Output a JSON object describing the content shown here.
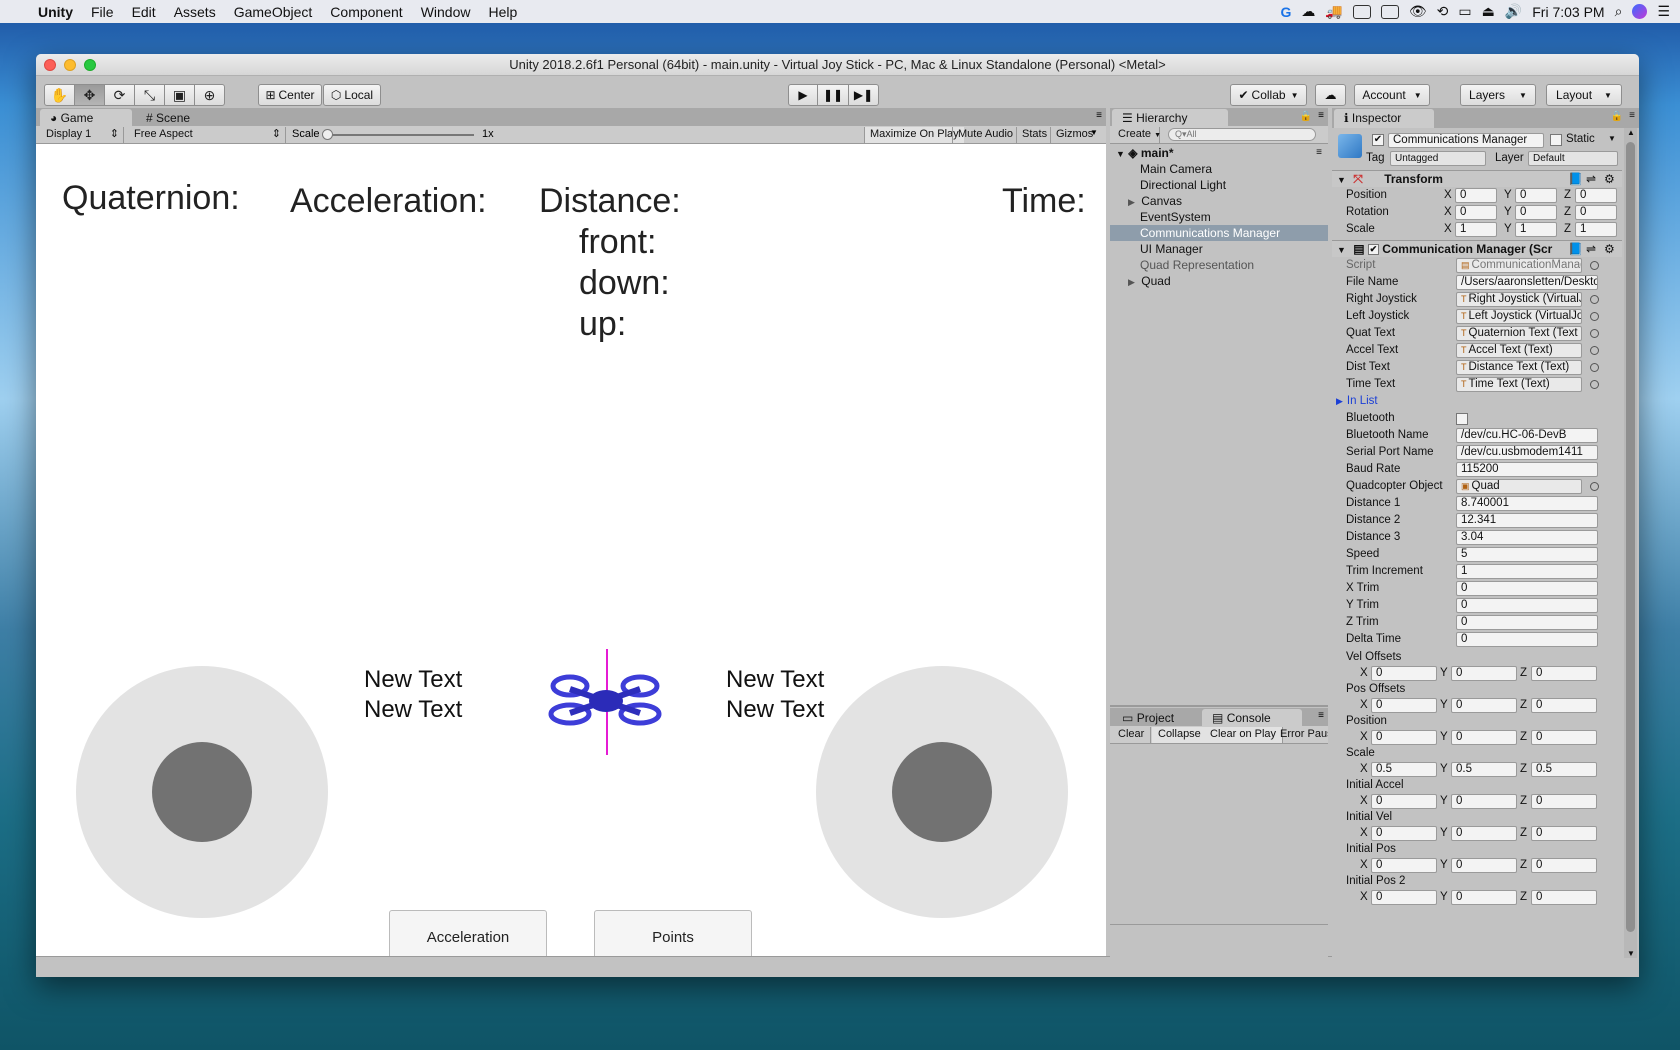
{
  "menubar": {
    "app": "Unity",
    "items": [
      "File",
      "Edit",
      "Assets",
      "GameObject",
      "Component",
      "Window",
      "Help"
    ],
    "clock": "Fri 7:03 PM"
  },
  "window": {
    "title": "Unity 2018.2.6f1 Personal (64bit) - main.unity - Virtual Joy Stick - PC, Mac & Linux Standalone (Personal) <Metal>"
  },
  "toolbar": {
    "pivot": "Center",
    "space": "Local",
    "collab": "Collab",
    "account": "Account",
    "layers": "Layers",
    "layout": "Layout"
  },
  "game_panel": {
    "tabs": [
      "Game",
      "Scene"
    ],
    "display": "Display 1",
    "aspect": "Free Aspect",
    "scale_label": "Scale",
    "scale_value": "1x",
    "buttons": [
      "Maximize On Play",
      "Mute Audio",
      "Stats",
      "Gizmos"
    ]
  },
  "game": {
    "quaternion": "Quaternion:",
    "acceleration": "Acceleration:",
    "distance": "Distance:",
    "front": "front:",
    "down": "down:",
    "up": "up:",
    "time": "Time:",
    "left_text_1": "New Text",
    "left_text_2": "New Text",
    "right_text_1": "New Text",
    "right_text_2": "New Text",
    "btn_acceleration": "Acceleration",
    "btn_points": "Points"
  },
  "hierarchy": {
    "tab": "Hierarchy",
    "create": "Create",
    "search_placeholder": "Q▾All",
    "scene": "main*",
    "items": [
      "Main Camera",
      "Directional Light",
      "Canvas",
      "EventSystem",
      "Communications Manager",
      "UI Manager",
      "Quad Representation",
      "Quad"
    ]
  },
  "bottom_panel": {
    "tabs": [
      "Project",
      "Console"
    ],
    "buttons": [
      "Clear",
      "Collapse",
      "Clear on Play",
      "Error Pause"
    ]
  },
  "inspector": {
    "tab": "Inspector",
    "object_name": "Communications Manager",
    "static": "Static",
    "tag_label": "Tag",
    "tag": "Untagged",
    "layer_label": "Layer",
    "layer": "Default",
    "transform": {
      "title": "Transform",
      "rows": [
        {
          "label": "Position",
          "x": "0",
          "y": "0",
          "z": "0"
        },
        {
          "label": "Rotation",
          "x": "0",
          "y": "0",
          "z": "0"
        },
        {
          "label": "Scale",
          "x": "1",
          "y": "1",
          "z": "1"
        }
      ]
    },
    "component_title": "Communication Manager (Scr",
    "fields": [
      {
        "label": "Script",
        "value": "CommunicationManag"
      },
      {
        "label": "File Name",
        "value": "/Users/aaronsletten/Deskto"
      },
      {
        "label": "Right Joystick",
        "value": "Right Joystick (VirtualJ"
      },
      {
        "label": "Left Joystick",
        "value": "Left Joystick (VirtualJoy"
      },
      {
        "label": "Quat Text",
        "value": "Quaternion Text (Text"
      },
      {
        "label": "Accel Text",
        "value": "Accel Text (Text)"
      },
      {
        "label": "Dist Text",
        "value": "Distance Text (Text)"
      },
      {
        "label": "Time Text",
        "value": "Time Text (Text)"
      },
      {
        "label": "In List",
        "value": ""
      },
      {
        "label": "Bluetooth",
        "value": ""
      },
      {
        "label": "Bluetooth Name",
        "value": "/dev/cu.HC-06-DevB"
      },
      {
        "label": "Serial Port Name",
        "value": "/dev/cu.usbmodem1411"
      },
      {
        "label": "Baud Rate",
        "value": "115200"
      },
      {
        "label": "Quadcopter Object",
        "value": "Quad"
      },
      {
        "label": "Distance 1",
        "value": "8.740001"
      },
      {
        "label": "Distance 2",
        "value": "12.341"
      },
      {
        "label": "Distance 3",
        "value": "3.04"
      },
      {
        "label": "Speed",
        "value": "5"
      },
      {
        "label": "Trim Increment",
        "value": "1"
      },
      {
        "label": "X Trim",
        "value": "0"
      },
      {
        "label": "Y Trim",
        "value": "0"
      },
      {
        "label": "Z Trim",
        "value": "0"
      },
      {
        "label": "Delta Time",
        "value": "0"
      }
    ],
    "vectors": [
      {
        "label": "Vel Offsets",
        "x": "0",
        "y": "0",
        "z": "0"
      },
      {
        "label": "Pos Offsets",
        "x": "0",
        "y": "0",
        "z": "0"
      },
      {
        "label": "Position",
        "x": "0",
        "y": "0",
        "z": "0"
      },
      {
        "label": "Scale",
        "x": "0.5",
        "y": "0.5",
        "z": "0.5"
      },
      {
        "label": "Initial Accel",
        "x": "0",
        "y": "0",
        "z": "0"
      },
      {
        "label": "Initial Vel",
        "x": "0",
        "y": "0",
        "z": "0"
      },
      {
        "label": "Initial Pos",
        "x": "0",
        "y": "0",
        "z": "0"
      },
      {
        "label": "Initial Pos 2",
        "x": "0",
        "y": "0",
        "z": "0"
      }
    ]
  }
}
